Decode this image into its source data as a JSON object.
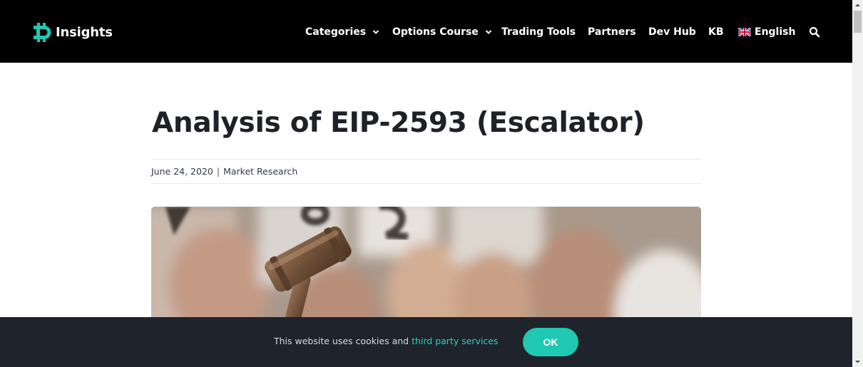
{
  "header": {
    "logo_text": "Insights",
    "brand_color": "#1fc8b3",
    "nav": [
      {
        "label": "Categories",
        "has_dropdown": true
      },
      {
        "label": "Options Course",
        "has_dropdown": true
      },
      {
        "label": "Trading Tools",
        "has_dropdown": false
      },
      {
        "label": "Partners",
        "has_dropdown": false
      },
      {
        "label": "Dev Hub",
        "has_dropdown": false
      },
      {
        "label": "KB",
        "has_dropdown": false
      },
      {
        "label": "English",
        "has_dropdown": false,
        "icon": "uk-flag-icon"
      }
    ],
    "search_icon": "search-icon"
  },
  "article": {
    "title": "Analysis of EIP-2593 (Escalator)",
    "date": "June 24, 2020",
    "separator": "|",
    "category": "Market Research",
    "hero_image": "auction gavel with bidding paddles"
  },
  "cookie_bar": {
    "text": "This website uses cookies and",
    "link_text": "third party services",
    "button_label": "OK"
  }
}
